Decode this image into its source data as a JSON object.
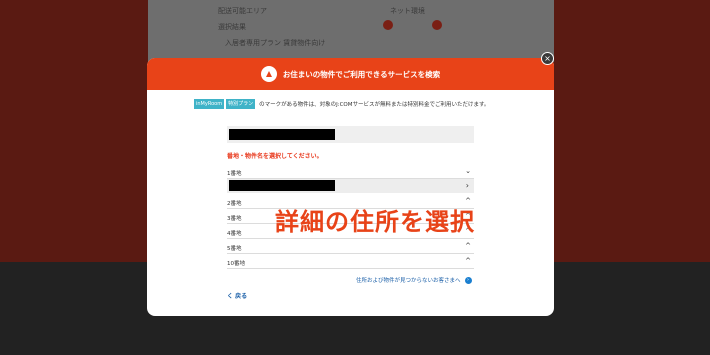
{
  "background": {
    "items": [
      "配送可能エリア",
      "選択結果",
      "入居者専用プラン 賃貸物件向け",
      "ネット環境"
    ]
  },
  "modal": {
    "title": "お住まいの物件でご利用できるサービスを検索",
    "close": "×",
    "tags": [
      "inMyRoom",
      "特別プラン"
    ],
    "tag_note": "のマークがある物件は、対象のJ:COMサービスが無料または特別料金でご利用いただけます。",
    "error": "番地・物件名を選択してください。",
    "rows": [
      {
        "label": "1番地",
        "chevron": "⌄"
      },
      {
        "label": "2番地",
        "chevron": "^"
      },
      {
        "label": "3番地",
        "chevron": "^"
      },
      {
        "label": "4番地",
        "chevron": "^"
      },
      {
        "label": "5番地",
        "chevron": "^"
      },
      {
        "label": "10番地",
        "chevron": "^"
      }
    ],
    "sub_row_chevron": "›",
    "help_link": "住所および物件が見つからないお客さまへ",
    "help_icon": "›",
    "back": "く 戻る"
  },
  "overlay": "詳細の住所を選択",
  "colors": {
    "accent": "#e84318",
    "tag": "#3fb3c8",
    "link": "#1a5fa8"
  }
}
